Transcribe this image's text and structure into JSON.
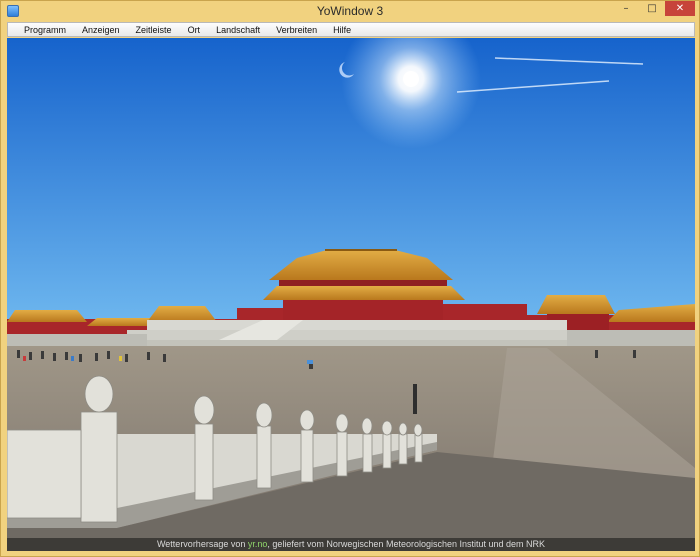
{
  "window": {
    "title": "YoWindow 3",
    "controls": {
      "minimize": "–",
      "maximize": "□",
      "close": "✕"
    }
  },
  "menu": {
    "items": [
      "Programm",
      "Anzeigen",
      "Zeitleiste",
      "Ort",
      "Landschaft",
      "Verbreiten",
      "Hilfe"
    ]
  },
  "scene": {
    "sky_top": "#1663cc",
    "sky_bottom": "#6fb8ef",
    "sun": "#ffffff",
    "roof": "#d79a2a",
    "wall": "#a8262a",
    "marble": "#d8d8d2",
    "ground": "#8f867b"
  },
  "footer": {
    "prefix": "Wettervorhersage von",
    "link": "yr.no",
    "suffix": ", geliefert vom Norwegischen Meteorologischen Institut und dem NRK"
  }
}
